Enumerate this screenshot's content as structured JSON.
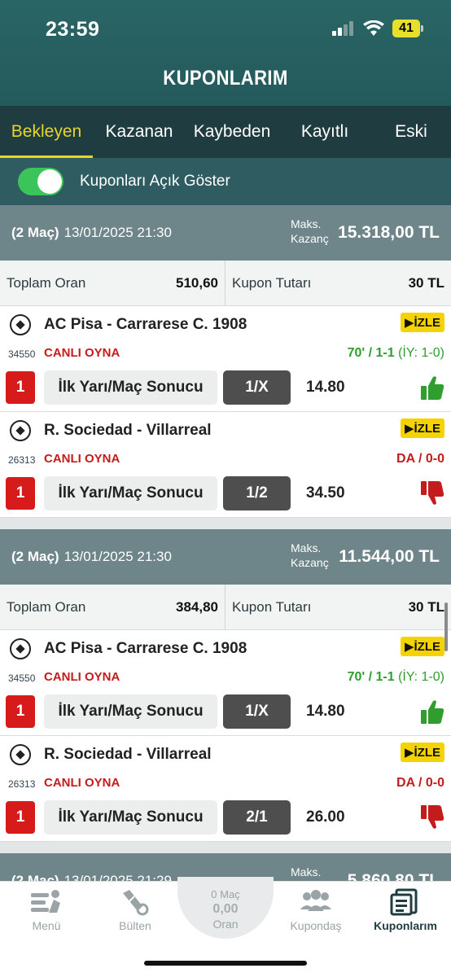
{
  "status_bar": {
    "time": "23:59",
    "battery": "41"
  },
  "header": {
    "title": "KUPONLARIM"
  },
  "tabs": [
    {
      "label": "Bekleyen",
      "active": true
    },
    {
      "label": "Kazanan",
      "active": false
    },
    {
      "label": "Kaybeden",
      "active": false
    },
    {
      "label": "Kayıtlı",
      "active": false
    },
    {
      "label": "Eski",
      "active": false
    }
  ],
  "toggle": {
    "label": "Kuponları Açık Göster",
    "on": true
  },
  "labels": {
    "maks": "Maks.",
    "kazanc": "Kazanç",
    "total_odds": "Toplam Oran",
    "coupon_amount": "Kupon Tutarı",
    "watch": "İZLE",
    "live_play": "CANLI OYNA"
  },
  "coupons": [
    {
      "count": "(2 Maç)",
      "date": "13/01/2025 21:30",
      "max_win": "15.318,00 TL",
      "total_odds": "510,60",
      "amount": "30 TL",
      "matches": [
        {
          "id": "34550",
          "teams": "AC Pisa - Carrarese C. 1908",
          "score": "70' / 1-1",
          "score_ht": "(İY: 1-0)",
          "score_color": "green",
          "rank": "1",
          "market": "İlk Yarı/Maç Sonucu",
          "pick": "1/X",
          "odd": "14.80",
          "result": "thumbs-up"
        },
        {
          "id": "26313",
          "teams": "R. Sociedad - Villarreal",
          "score": "DA / 0-0",
          "score_ht": "",
          "score_color": "red",
          "rank": "1",
          "market": "İlk Yarı/Maç Sonucu",
          "pick": "1/2",
          "odd": "34.50",
          "result": "thumbs-down"
        }
      ]
    },
    {
      "count": "(2 Maç)",
      "date": "13/01/2025 21:30",
      "max_win": "11.544,00 TL",
      "total_odds": "384,80",
      "amount": "30 TL",
      "matches": [
        {
          "id": "34550",
          "teams": "AC Pisa - Carrarese C. 1908",
          "score": "70' / 1-1",
          "score_ht": "(İY: 1-0)",
          "score_color": "green",
          "rank": "1",
          "market": "İlk Yarı/Maç Sonucu",
          "pick": "1/X",
          "odd": "14.80",
          "result": "thumbs-up"
        },
        {
          "id": "26313",
          "teams": "R. Sociedad - Villarreal",
          "score": "DA / 0-0",
          "score_ht": "",
          "score_color": "red",
          "rank": "1",
          "market": "İlk Yarı/Maç Sonucu",
          "pick": "2/1",
          "odd": "26.00",
          "result": "thumbs-down"
        }
      ]
    },
    {
      "count": "(2 Maç)",
      "date": "13/01/2025 21:29",
      "max_win": "5.860,80 TL",
      "total_odds": "",
      "amount": "",
      "matches": []
    }
  ],
  "bottom_nav": {
    "items": [
      {
        "label": "Menü",
        "icon": "menu-person-icon",
        "active": false
      },
      {
        "label": "Bülten",
        "icon": "bulletin-icon",
        "active": false
      },
      {
        "label": "Kupondaş",
        "icon": "group-icon",
        "active": false
      },
      {
        "label": "Kuponlarım",
        "icon": "coupons-icon",
        "active": true
      }
    ],
    "bet_slip": {
      "matches": "0 Maç",
      "odds_value": "0,00",
      "odds_label": "Oran"
    }
  },
  "colors": {
    "header": "#2a6566",
    "tabs": "#1f3c41",
    "active_tab": "#e9d52a",
    "coupon_head": "#6e8589",
    "live": "#c41c1c",
    "win": "#2f9e2f",
    "watch": "#f5d300"
  }
}
